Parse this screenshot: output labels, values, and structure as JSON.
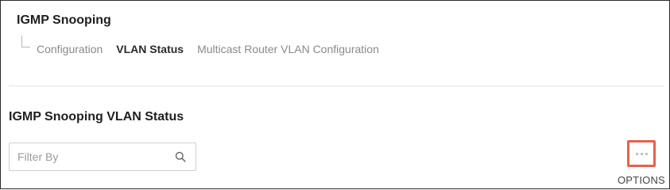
{
  "header": {
    "title": "IGMP Snooping"
  },
  "tabs": [
    {
      "label": "Configuration",
      "active": false
    },
    {
      "label": "VLAN Status",
      "active": true
    },
    {
      "label": "Multicast Router VLAN Configuration",
      "active": false
    }
  ],
  "section": {
    "title": "IGMP Snooping VLAN Status"
  },
  "filter": {
    "placeholder": "Filter By",
    "value": "",
    "icon": "search-icon"
  },
  "options": {
    "label": "OPTIONS",
    "icon": "more-dots-icon",
    "highlight_color": "#e8604c"
  }
}
